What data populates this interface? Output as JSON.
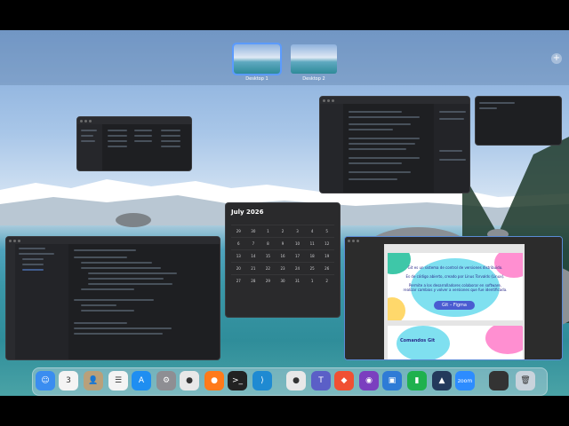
{
  "spaces": [
    {
      "label": "Desktop 1",
      "active": true
    },
    {
      "label": "Desktop 2",
      "active": false
    }
  ],
  "add_space_label": "+",
  "calendar": {
    "title": "July 2026",
    "days": [
      "29",
      "30",
      "1",
      "2",
      "3",
      "4",
      "5",
      "6",
      "7",
      "8",
      "9",
      "10",
      "11",
      "12",
      "13",
      "14",
      "15",
      "16",
      "17",
      "18",
      "19",
      "20",
      "21",
      "22",
      "23",
      "24",
      "25",
      "26",
      "27",
      "28",
      "29",
      "30",
      "31",
      "1",
      "2"
    ]
  },
  "figma": {
    "line1": "Git es un sistema de control de versiones distribuido.",
    "line2": "Es de código abierto, creado por Linus Torvalds (Linux).",
    "line3": "Permite a los desarrolladores colaborar en software, realizar cambios y volver a versiones que fue identificada.",
    "button": "Git – Figma",
    "section_title": "Comandos Git"
  },
  "dock": [
    {
      "name": "finder-icon",
      "glyph": "☺",
      "color": "#3a8df0"
    },
    {
      "name": "calendar-icon",
      "glyph": "3",
      "color": "#f4f4f4"
    },
    {
      "name": "contacts-icon",
      "glyph": "👤",
      "color": "#b9a07a"
    },
    {
      "name": "reminders-icon",
      "glyph": "☰",
      "color": "#f4f4f4"
    },
    {
      "name": "app-store-icon",
      "glyph": "A",
      "color": "#1f8ef1"
    },
    {
      "name": "system-settings-icon",
      "glyph": "⚙",
      "color": "#8e8e93"
    },
    {
      "name": "chrome-icon",
      "glyph": "●",
      "color": "#e8e8e8"
    },
    {
      "name": "firefox-icon",
      "glyph": "●",
      "color": "#ff7a1a"
    },
    {
      "name": "terminal-icon",
      "glyph": ">_",
      "color": "#222"
    },
    {
      "name": "vscode-icon",
      "glyph": "⟩",
      "color": "#1f8ad2"
    },
    {
      "name": "chrome-2-icon",
      "glyph": "●",
      "color": "#e8e8e8"
    },
    {
      "name": "teams-icon",
      "glyph": "T",
      "color": "#5b5fc7"
    },
    {
      "name": "git-icon",
      "glyph": "◆",
      "color": "#f05033"
    },
    {
      "name": "github-desktop-icon",
      "glyph": "◉",
      "color": "#7b3fbf"
    },
    {
      "name": "virtualbox-icon",
      "glyph": "▣",
      "color": "#2e7bd6"
    },
    {
      "name": "numbers-icon",
      "glyph": "▮",
      "color": "#1fb14e"
    },
    {
      "name": "android-studio-icon",
      "glyph": "▲",
      "color": "#233a5c"
    },
    {
      "name": "zoom-icon",
      "glyph": "zoom",
      "color": "#2d8cff"
    },
    {
      "name": "window-preview-icon",
      "glyph": "",
      "color": "#333"
    },
    {
      "name": "trash-icon",
      "glyph": "🗑",
      "color": "#c9d3dc"
    }
  ]
}
